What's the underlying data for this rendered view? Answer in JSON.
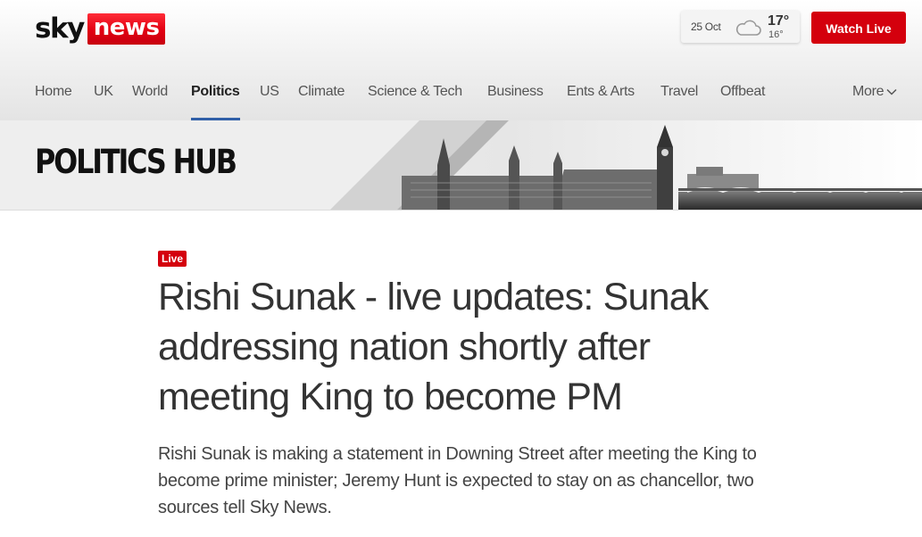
{
  "brand": {
    "sky": "sky",
    "news": "news"
  },
  "weather": {
    "date": "25 Oct",
    "icon": "cloud-icon",
    "high": "17°",
    "low": "16°"
  },
  "header": {
    "watch_live_label": "Watch Live"
  },
  "nav": {
    "items": [
      {
        "label": "Home"
      },
      {
        "label": "UK"
      },
      {
        "label": "World"
      },
      {
        "label": "Politics",
        "active": true
      },
      {
        "label": "US"
      },
      {
        "label": "Climate"
      },
      {
        "label": "Science & Tech"
      },
      {
        "label": "Business"
      },
      {
        "label": "Ents & Arts"
      },
      {
        "label": "Travel"
      },
      {
        "label": "Offbeat"
      }
    ],
    "more_label": "More"
  },
  "hub": {
    "title": "POLITICS HUB"
  },
  "article": {
    "badge": "Live",
    "headline": "Rishi Sunak - live updates: Sunak addressing nation shortly after meeting King to become PM",
    "standfirst": "Rishi Sunak is making a statement in Downing Street after meeting the King to become prime minister; Jeremy Hunt is expected to stay on as chancellor, two sources tell Sky News."
  },
  "colors": {
    "brand_red": "#d4000d",
    "active_underline": "#2f5fa8",
    "text": "#333333"
  }
}
